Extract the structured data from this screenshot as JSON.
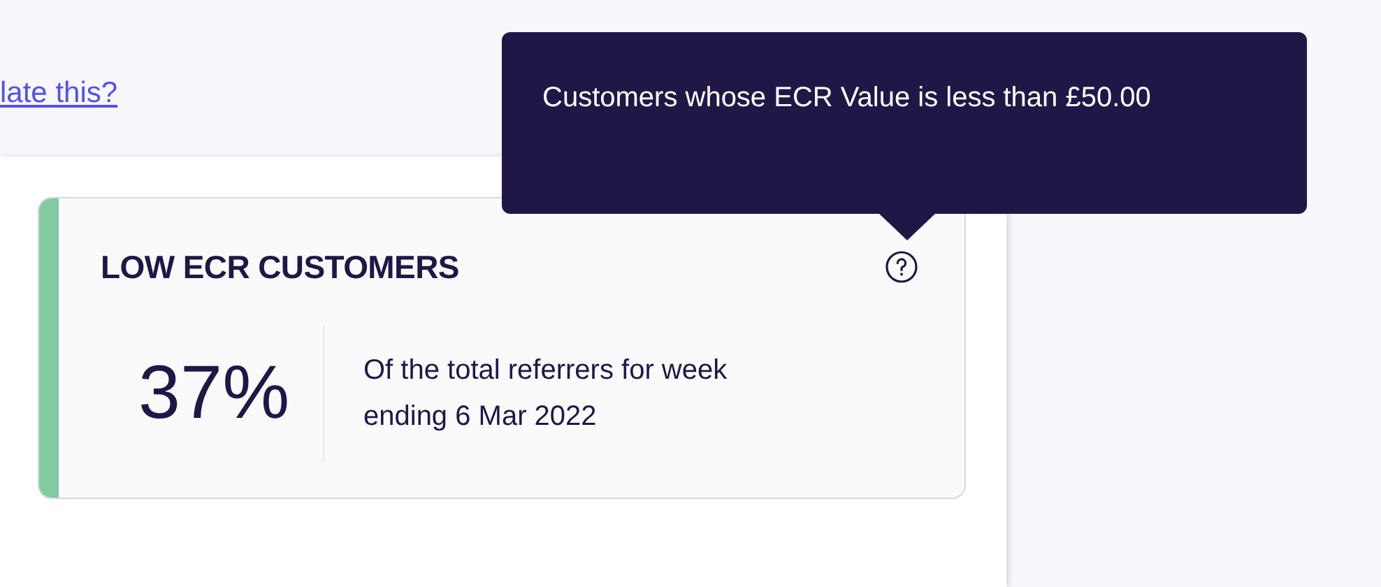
{
  "link": {
    "text": "late this?"
  },
  "card": {
    "title": "LOW ECR CUSTOMERS",
    "value": "37%",
    "description": "Of the total referrers for week ending 6 Mar 2022"
  },
  "tooltip": {
    "text": "Customers whose ECR Value is less than £50.00"
  }
}
